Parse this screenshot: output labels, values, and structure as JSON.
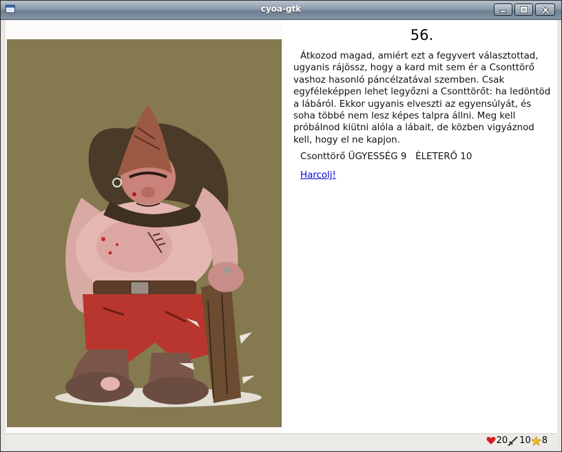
{
  "window": {
    "title": "cyoa-gtk"
  },
  "section": {
    "number": "56.",
    "text": "Átkozod magad, amiért ezt a fegyvert választottad, ugyanis rájössz, hogy a kard mit sem ér a Csonttörő vashoz hasonló páncélzatával szemben. Csak egyféleképpen lehet legyőzni a Csonttörőt: ha ledöntöd a lábáról. Ekkor ugyanis elveszti az egyensúlyát, és soha többé nem lesz képes talpra állni. Meg kell próbálnod kiütni alóla a lábait, de közben vigyáznod kell, hogy el ne kapjon.",
    "enemy": "Csonttörő ÜGYESSÉG 9   ÉLETERŐ 10",
    "link": "Harcolj!"
  },
  "illustration": {
    "background_color": "#84794f"
  },
  "status": {
    "hp_icon": "heart-icon",
    "hp": "20",
    "skill_icon": "sword-icon",
    "skill": "10",
    "luck_icon": "star-icon",
    "luck": "8"
  }
}
